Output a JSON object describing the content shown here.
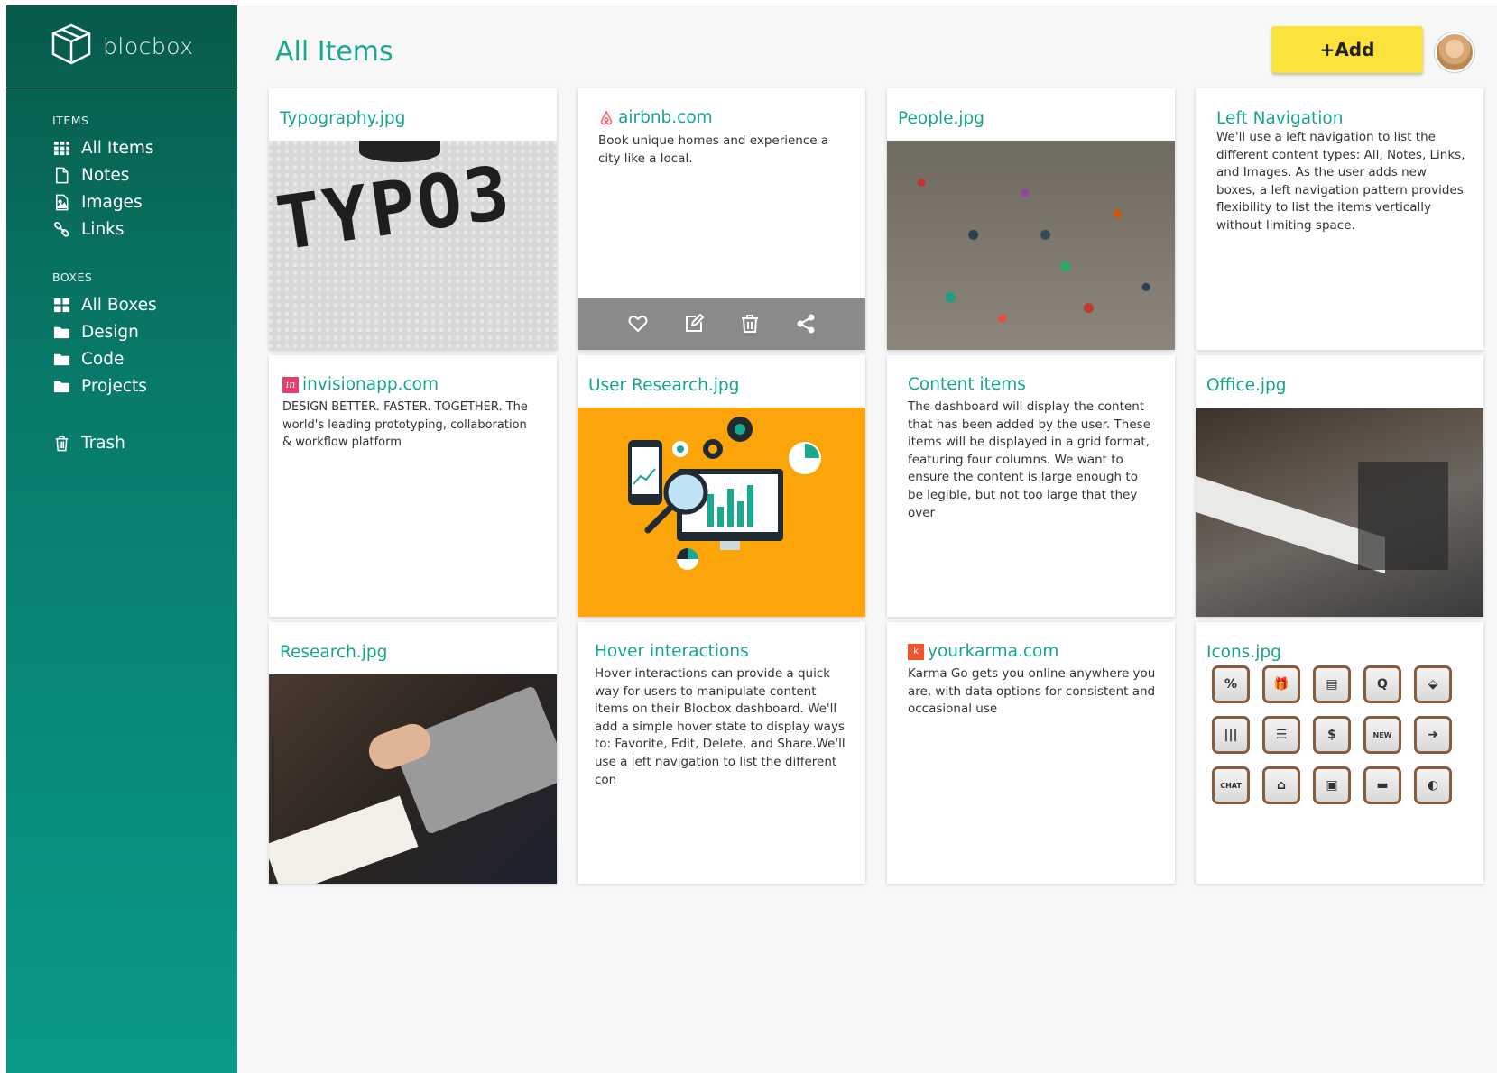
{
  "app": {
    "name": "blocbox"
  },
  "sidebar": {
    "items_heading": "ITEMS",
    "items": [
      {
        "label": "All Items",
        "icon": "grid-icon"
      },
      {
        "label": "Notes",
        "icon": "note-icon"
      },
      {
        "label": "Images",
        "icon": "image-icon"
      },
      {
        "label": "Links",
        "icon": "link-icon"
      }
    ],
    "boxes_heading": "BOXES",
    "boxes": [
      {
        "label": "All Boxes",
        "icon": "boxes-icon"
      },
      {
        "label": "Design",
        "icon": "folder-icon"
      },
      {
        "label": "Code",
        "icon": "folder-icon"
      },
      {
        "label": "Projects",
        "icon": "folder-icon"
      }
    ],
    "trash": "Trash"
  },
  "header": {
    "title": "All Items",
    "add_label": "+Add"
  },
  "cards": {
    "c1": {
      "title": "Typography.jpg",
      "image_text": "TYPO3"
    },
    "c2": {
      "title": "airbnb.com",
      "text": "Book unique homes and experience a city like a local."
    },
    "c3": {
      "title": "People.jpg"
    },
    "c4": {
      "title": "Left Navigation",
      "text": "We'll use a left navigation to list the different content types: All, Notes, Links, and Images. As the user adds new boxes, a left navigation pattern provides flexibility to list the items vertically without limiting space."
    },
    "c5": {
      "title": "invisionapp.com",
      "text": "DESIGN BETTER. FASTER. TOGETHER. The world's leading prototyping, collaboration & workflow platform"
    },
    "c6": {
      "title": "User Research.jpg"
    },
    "c7": {
      "title": "Content items",
      "text": "The dashboard will display the content that has been added by the user. These items will be displayed in a grid format, featuring four columns. We want to ensure the content is large enough to be legible, but not too large that they over"
    },
    "c8": {
      "title": "Office.jpg"
    },
    "c9": {
      "title": "Research.jpg"
    },
    "c10": {
      "title": "Hover interactions",
      "text": "Hover interactions can provide a quick way for users to manipulate content items on their Blocbox dashboard. We'll add a simple hover state to display ways to: Favorite, Edit, Delete, and Share.We'll use a left navigation to list the different con"
    },
    "c11": {
      "title": "yourkarma.com",
      "text": "Karma Go gets you online anywhere you are, with data options for consistent and occasional use"
    },
    "c12": {
      "title": "Icons.jpg",
      "tiles": [
        "%",
        "🎁",
        "▤",
        "Q",
        "⬙",
        "|||",
        "☰",
        "$",
        "NEW",
        "➜",
        "CHAT",
        "⌂",
        "▣",
        "▬",
        "◐"
      ]
    }
  },
  "colors": {
    "accent": "#17a58d",
    "sidebar": "#087a69",
    "add_button": "#fbe33b",
    "action_bar": "#8a8a8a"
  }
}
